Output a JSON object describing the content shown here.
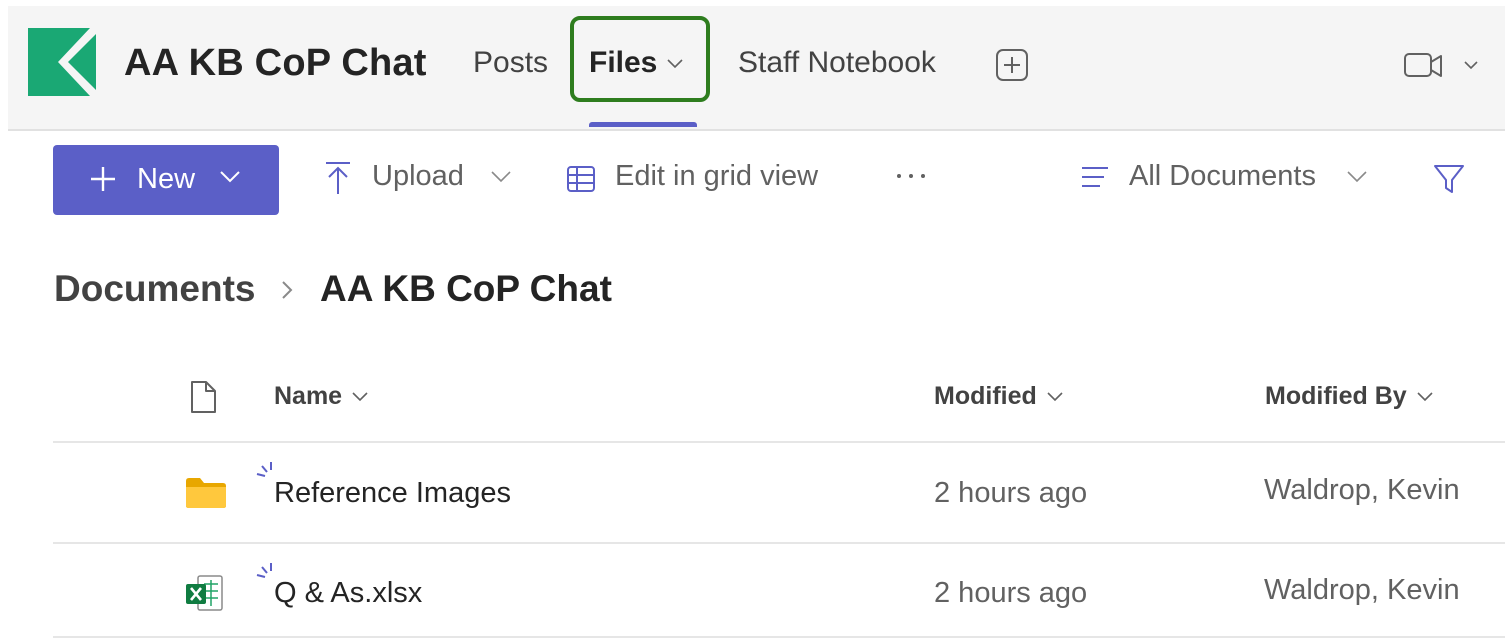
{
  "header": {
    "team_title": "AA KB CoP Chat",
    "tabs": [
      {
        "label": "Posts"
      },
      {
        "label": "Files"
      },
      {
        "label": "Staff Notebook"
      }
    ],
    "active_tab": "Files",
    "brand_color": "#1aa874",
    "accent_color": "#5b5fc7",
    "highlight_color": "#2e7d1e",
    "icons": [
      "add-tab-icon",
      "video-camera-icon",
      "chevron-down-icon"
    ]
  },
  "toolbar": {
    "new_label": "New",
    "upload_label": "Upload",
    "grid_label": "Edit in grid view",
    "view_label": "All Documents",
    "icons": [
      "plus-icon",
      "upload-icon",
      "grid-icon",
      "more-icon",
      "view-lines-icon",
      "filter-icon"
    ]
  },
  "breadcrumb": {
    "root": "Documents",
    "current": "AA KB CoP Chat"
  },
  "table": {
    "columns": [
      "Name",
      "Modified",
      "Modified By"
    ],
    "rows": [
      {
        "type": "folder",
        "name": "Reference Images",
        "modified": "2 hours ago",
        "modified_by": "Waldrop, Kevin"
      },
      {
        "type": "excel",
        "name": "Q & As.xlsx",
        "modified": "2 hours ago",
        "modified_by": "Waldrop, Kevin"
      }
    ]
  }
}
